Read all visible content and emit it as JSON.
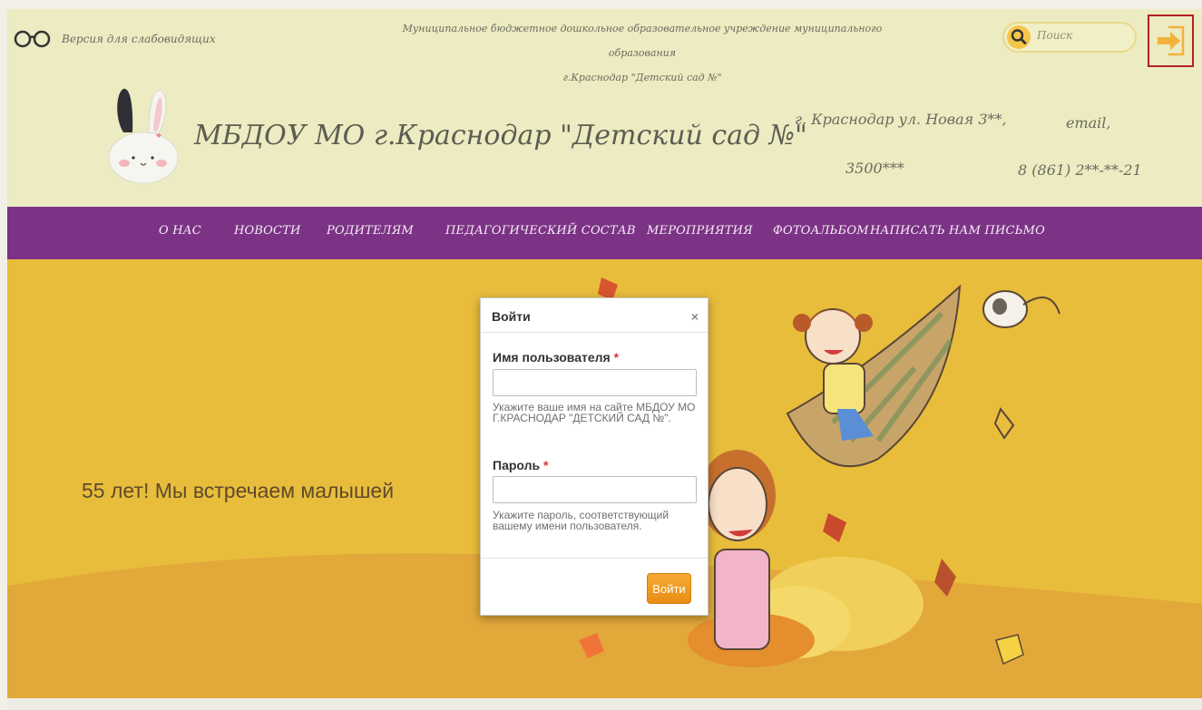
{
  "header": {
    "accessibility_label": "Версия для слабовидящих",
    "org_full_line1": "Муниципальное бюджетное дошкольное образовательное учреждение муниципального образования",
    "org_full_line2": "г.Краснодар  \"Детский сад №\"",
    "search_placeholder": "Поиск",
    "site_title": "МБДОУ МО г.Краснодар \"Детский сад №\"",
    "address_line1": "г. Краснодар ул. Новая 3**,",
    "address_line2": "3500***",
    "email": "email,",
    "phone": "8 (861) 2**-**-21",
    "login_icon": "login-arrow-icon"
  },
  "nav": {
    "items": [
      {
        "label": "О НАС"
      },
      {
        "label": "НОВОСТИ"
      },
      {
        "label": "РОДИТЕЛЯМ"
      },
      {
        "label": "ПЕДАГОГИЧЕСКИЙ СОСТАВ"
      },
      {
        "label": "МЕРОПРИЯТИЯ"
      },
      {
        "label": "ФОТОАЛЬБОМ"
      },
      {
        "label": "НАПИСАТЬ НАМ ПИСЬМО"
      }
    ]
  },
  "hero": {
    "text": "55 лет! Мы встречаем малышей"
  },
  "login_modal": {
    "title": "Войти",
    "close": "×",
    "username_label": "Имя пользователя",
    "required_mark": "*",
    "username_value": "",
    "username_hint": "Укажите ваше имя на сайте МБДОУ МО Г.КРАСНОДАР \"ДЕТСКИЙ САД №\".",
    "password_label": "Пароль",
    "password_value": "",
    "password_hint": "Укажите пароль, соответствующий вашему имени пользователя.",
    "submit_label": "Войти"
  },
  "colors": {
    "header_bg": "#ecebc1",
    "nav_bg": "#7c3385",
    "hero_bg": "#e8bd3b",
    "accent_orange": "#f0991f",
    "login_border": "#b32121"
  }
}
